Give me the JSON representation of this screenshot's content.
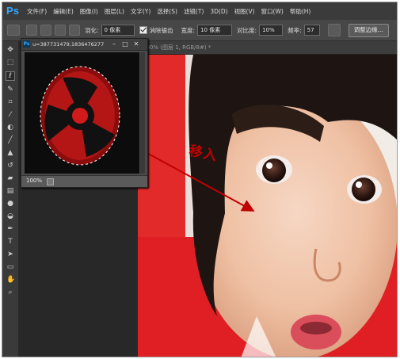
{
  "menubar": {
    "logo": "Ps",
    "items": [
      "文件(F)",
      "编辑(E)",
      "图像(I)",
      "图层(L)",
      "文字(Y)",
      "选择(S)",
      "滤镜(T)",
      "3D(D)",
      "视图(V)",
      "窗口(W)",
      "帮助(H)"
    ]
  },
  "options": {
    "feather_label": "羽化:",
    "feather_value": "0 像素",
    "antialias_label": "消除锯齿",
    "width_label": "宽度:",
    "width_value": "10 像素",
    "contrast_label": "对比度:",
    "contrast_value": "10%",
    "frequency_label": "频率:",
    "frequency_value": "57",
    "refine_edge": "调整边缘..."
  },
  "document": {
    "tab_title": "100% (图层 1, RGB/8#) *"
  },
  "float_window": {
    "title": "u=387731479,1836476277...",
    "zoom": "100%"
  },
  "annotation": {
    "text": "移入",
    "color": "#c00000"
  },
  "colors": {
    "accent": "#31a8ff",
    "panel": "#535353",
    "arrow": "#c00000"
  }
}
